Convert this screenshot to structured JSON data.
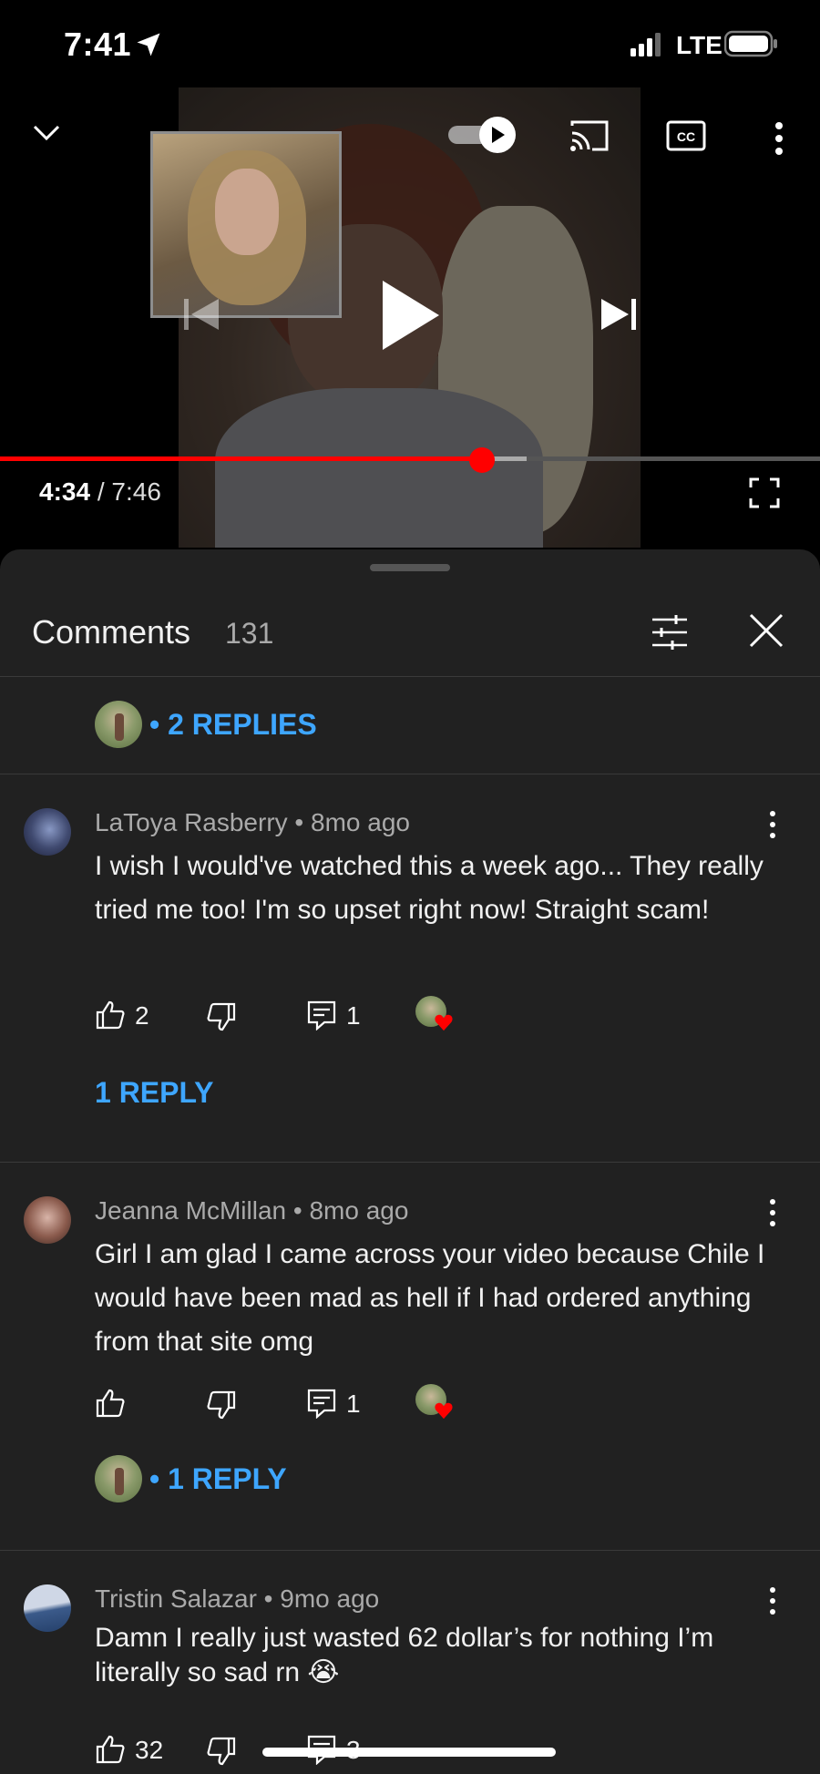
{
  "status_bar": {
    "time": "7:41",
    "network": "LTE"
  },
  "player": {
    "current_time": "4:34",
    "separator": "/",
    "duration": "7:46",
    "progress_fraction": 0.588,
    "buffered_fraction": 0.642,
    "icons": [
      "chevron-down-icon",
      "autoplay-toggle-icon",
      "cast-icon",
      "cc-icon",
      "more-vert-icon",
      "previous-icon",
      "play-icon",
      "next-icon",
      "fullscreen-icon"
    ]
  },
  "comments_panel": {
    "title": "Comments",
    "count": "131",
    "top_replies_label": "2 REPLIES",
    "comments": [
      {
        "author": "LaToya Rasberry",
        "age": "8mo ago",
        "text": "I wish I would've watched this a week ago... They really tried me too! I'm so upset right now! Straight scam!",
        "likes": "2",
        "replies_count": "1",
        "replies_label": "1 REPLY"
      },
      {
        "author": "Jeanna McMillan",
        "age": "8mo ago",
        "text": "Girl I am glad I came across your video because Chile I would have been mad as hell if I had ordered anything from that site omg",
        "likes": "",
        "replies_count": "1",
        "replies_label": "1 REPLY"
      },
      {
        "author": "Tristin Salazar",
        "age": "9mo ago",
        "text": "Damn I really just wasted 62 dollar’s for nothing I’m literally so sad rn 😭",
        "likes": "32",
        "replies_count": "3"
      }
    ]
  },
  "colors": {
    "accent_link": "#3ea6ff",
    "progress": "#ff0000",
    "sheet_bg": "#212121",
    "heart": "#ff0000"
  }
}
